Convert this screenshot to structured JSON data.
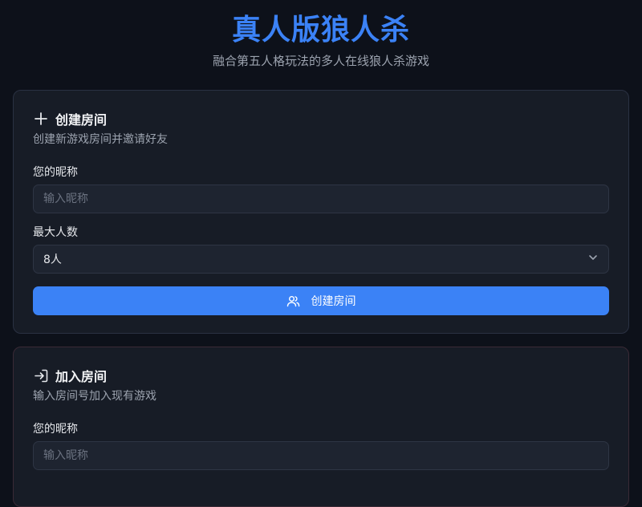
{
  "header": {
    "title": "真人版狼人杀",
    "subtitle": "融合第五人格玩法的多人在线狼人杀游戏"
  },
  "create_room": {
    "title": "创建房间",
    "description": "创建新游戏房间并邀请好友",
    "nickname_label": "您的昵称",
    "nickname_placeholder": "输入昵称",
    "max_players_label": "最大人数",
    "max_players_value": "8人",
    "submit_label": "创建房间",
    "icons": {
      "header": "plus-icon",
      "submit": "users-icon",
      "select": "chevron-down-icon"
    }
  },
  "join_room": {
    "title": "加入房间",
    "description": "输入房间号加入现有游戏",
    "nickname_label": "您的昵称",
    "nickname_placeholder": "输入昵称",
    "icons": {
      "header": "login-icon"
    }
  },
  "colors": {
    "accent": "#3b82f6",
    "background": "#0d111a",
    "card": "#171c26"
  }
}
